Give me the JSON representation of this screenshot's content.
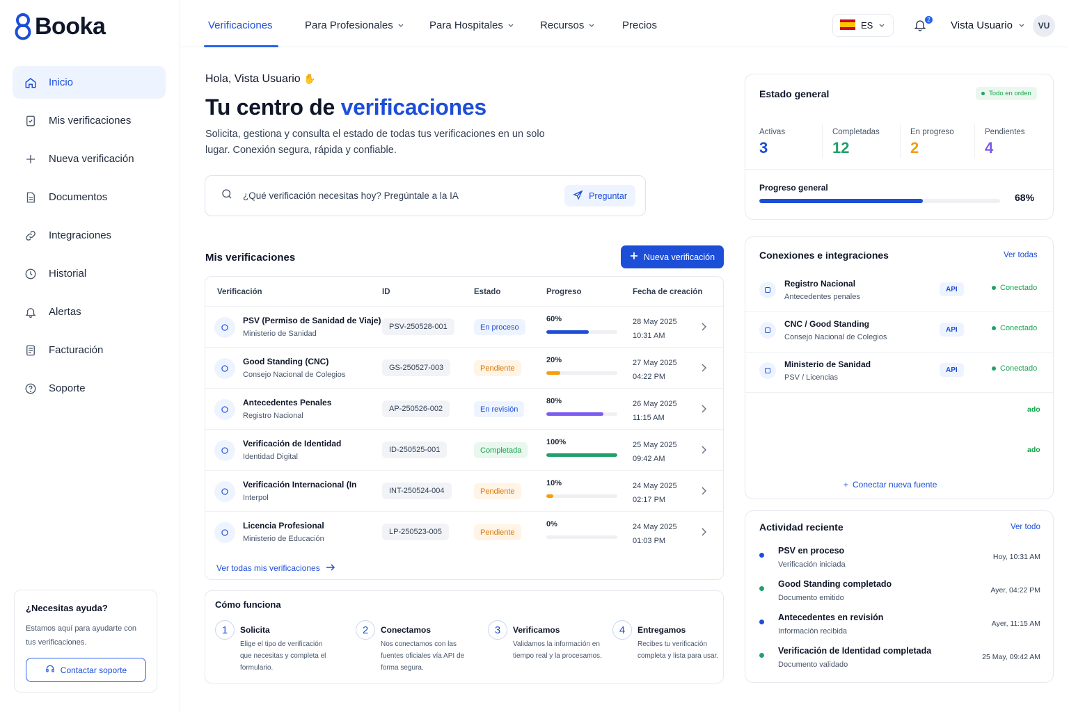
{
  "brand": {
    "name": "Booka",
    "accent": "#1d4ed8"
  },
  "sidebar": {
    "items": [
      {
        "label": "Inicio",
        "icon": "home-icon",
        "active": true
      },
      {
        "label": "Mis verificaciones",
        "icon": "document-check-icon"
      },
      {
        "label": "Nueva verificación",
        "icon": "plus-icon"
      },
      {
        "label": "Documentos",
        "icon": "file-icon"
      },
      {
        "label": "Integraciones",
        "icon": "link-icon"
      },
      {
        "label": "Historial",
        "icon": "clock-icon"
      },
      {
        "label": "Alertas",
        "icon": "bell-icon"
      },
      {
        "label": "Facturación",
        "icon": "receipt-icon"
      },
      {
        "label": "Soporte",
        "icon": "help-circle-icon"
      }
    ],
    "help": {
      "title": "¿Necesitas ayuda?",
      "text": "Estamos aquí para ayudarte con tus verificaciones.",
      "button": "Contactar soporte"
    }
  },
  "topnav": {
    "tabs": [
      {
        "label": "Verificaciones",
        "active": true
      },
      {
        "label": "Para Profesionales",
        "dropdown": true
      },
      {
        "label": "Para Hospitales",
        "dropdown": true
      },
      {
        "label": "Recursos",
        "dropdown": true
      },
      {
        "label": "Precios"
      }
    ],
    "language": "ES",
    "notifications": "2",
    "user_name": "Vista Usuario",
    "avatar_initials": "VU"
  },
  "hero": {
    "greeting": "Hola, Vista Usuario",
    "title_prefix": "Tu centro de ",
    "title_accent": "verificaciones",
    "description": "Solicita, gestiona y consulta el estado de todas tus verificaciones en un solo lugar. Conexión segura, rápida y confiable."
  },
  "ask": {
    "placeholder": "¿Qué verificación necesitas hoy? Pregúntale a la IA",
    "button": "Preguntar"
  },
  "verifications": {
    "title": "Mis verificaciones",
    "new_button": "Nueva verificación",
    "columns": [
      "Verificación",
      "ID",
      "Estado",
      "Progreso",
      "Fecha de creación"
    ],
    "rows": [
      {
        "name": "PSV (Permiso de Sanidad de Viaje)",
        "sub": "Ministerio de Sanidad",
        "id": "PSV-250528-001",
        "status": "En proceso",
        "progress_label": "60%",
        "progress": 0.6,
        "color": "#1d4ed8",
        "date": "28 May 2025",
        "time": "10:31 AM",
        "icon": "shield-icon"
      },
      {
        "name": "Good Standing (CNC)",
        "sub": "Consejo Nacional de Colegios",
        "id": "GS-250527-003",
        "status": "Pendiente",
        "progress_label": "20%",
        "progress": 0.2,
        "color": "#f59e0b",
        "date": "27 May 2025",
        "time": "04:22 PM",
        "icon": "institution-icon"
      },
      {
        "name": "Antecedentes Penales",
        "sub": "Registro Nacional",
        "id": "AP-250526-002",
        "status": "En revisión",
        "progress_label": "80%",
        "progress": 0.8,
        "color": "#7c5cf0",
        "date": "26 May 2025",
        "time": "11:15 AM",
        "icon": "fingerprint-icon"
      },
      {
        "name": "Verificación de Identidad",
        "sub": "Identidad Digital",
        "id": "ID-250525-001",
        "status": "Completada",
        "progress_label": "100%",
        "progress": 1.0,
        "color": "#22a06b",
        "date": "25 May 2025",
        "time": "09:42 AM",
        "icon": "id-card-icon"
      },
      {
        "name": "Verificación Internacional (In",
        "sub": "Interpol",
        "id": "INT-250524-004",
        "status": "Pendiente",
        "progress_label": "10%",
        "progress": 0.1,
        "color": "#f59e0b",
        "date": "24 May 2025",
        "time": "02:17 PM",
        "icon": "globe-icon"
      },
      {
        "name": "Licencia Profesional",
        "sub": "Ministerio de Educación",
        "id": "LP-250523-005",
        "status": "Pendiente",
        "progress_label": "0%",
        "progress": 0.0,
        "color": "#f59e0b",
        "date": "24 May 2025",
        "time": "01:03 PM",
        "icon": "badge-icon"
      }
    ],
    "see_all": "Ver todas mis verificaciones"
  },
  "how": {
    "title": "Cómo funciona",
    "steps": [
      {
        "num": "1",
        "title": "Solicita",
        "desc": "Elige el tipo de verificación que necesitas y completa el formulario."
      },
      {
        "num": "2",
        "title": "Conectamos",
        "desc": "Nos conectamos con las fuentes oficiales vía API de forma segura."
      },
      {
        "num": "3",
        "title": "Verificamos",
        "desc": "Validamos la información en tiempo real y la procesamos."
      },
      {
        "num": "4",
        "title": "Entregamos",
        "desc": "Recibes tu verificación completa y lista para usar."
      }
    ]
  },
  "status_card": {
    "title": "Estado general",
    "badge": "Todo en orden",
    "stats": [
      {
        "label": "Activas",
        "value": "3",
        "color": "#1d4ed8"
      },
      {
        "label": "Completadas",
        "value": "12",
        "color": "#22a06b"
      },
      {
        "label": "En progreso",
        "value": "2",
        "color": "#f59e0b"
      },
      {
        "label": "Pendientes",
        "value": "4",
        "color": "#7c5cf0"
      }
    ],
    "progress_label": "Progreso general",
    "progress_value": "68%",
    "progress": 0.68
  },
  "connections": {
    "title": "Conexiones e integraciones",
    "see_all": "Ver todas",
    "items": [
      {
        "name": "Registro Nacional",
        "sub": "Antecedentes penales",
        "tag": "API",
        "status": "Conectado",
        "icon": "shield-down-icon"
      },
      {
        "name": "CNC / Good Standing",
        "sub": "Consejo Nacional de Colegios",
        "tag": "API",
        "status": "Conectado",
        "icon": "building-icon"
      },
      {
        "name": "Ministerio de Sanidad",
        "sub": "PSV / Licencias",
        "tag": "API",
        "status": "Conectado",
        "icon": "medical-icon"
      }
    ],
    "faded": [
      "ado",
      "ado"
    ],
    "add": "Conectar nueva fuente"
  },
  "activity": {
    "title": "Actividad reciente",
    "see_all": "Ver todo",
    "items": [
      {
        "name": "PSV en proceso",
        "sub": "Verificación iniciada",
        "time": "Hoy, 10:31 AM",
        "color": "#1d4ed8"
      },
      {
        "name": "Good Standing completado",
        "sub": "Documento emitido",
        "time": "Ayer, 04:22 PM",
        "color": "#22a06b"
      },
      {
        "name": "Antecedentes en revisión",
        "sub": "Información recibida",
        "time": "Ayer, 11:15 AM",
        "color": "#1d4ed8"
      },
      {
        "name": "Verificación de Identidad completada",
        "sub": "Documento validado",
        "time": "25 May, 09:42 AM",
        "color": "#22a06b"
      }
    ]
  }
}
